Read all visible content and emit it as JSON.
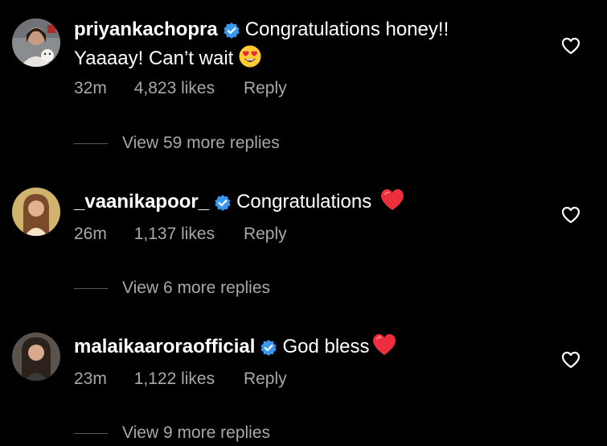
{
  "comments": [
    {
      "username": "priyankachopra",
      "verified": true,
      "text_line1": "Congratulations honey!!",
      "text_line2": "Yaaaay! Can’t wait",
      "emoji": "heart-eyes-emoji",
      "time": "32m",
      "likes": "4,823 likes",
      "reply_label": "Reply",
      "view_replies": "View 59 more replies"
    },
    {
      "username": "_vaanikapoor_",
      "verified": true,
      "text_line1": "Congratulations",
      "emoji": "red-heart-emoji",
      "time": "26m",
      "likes": "1,137 likes",
      "reply_label": "Reply",
      "view_replies": "View 6 more replies"
    },
    {
      "username": "malaikaaroraofficial",
      "verified": true,
      "text_line1": "God bless",
      "emoji": "red-heart-emoji",
      "time": "23m",
      "likes": "1,122 likes",
      "reply_label": "Reply",
      "view_replies": "View 9 more replies"
    }
  ],
  "colors": {
    "background": "#000000",
    "text": "#ffffff",
    "secondary": "#a8a8a8",
    "verified_badge": "#3897f0",
    "heart": "#ed2e3c"
  }
}
